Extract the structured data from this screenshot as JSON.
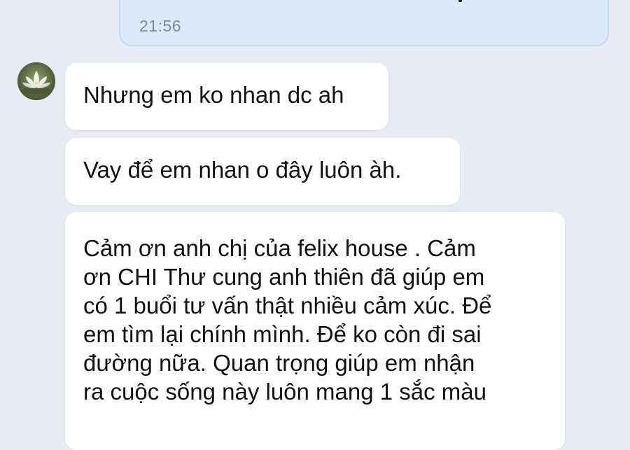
{
  "conversation": {
    "outgoing": {
      "time": "21:56"
    },
    "incoming": [
      {
        "text": "Nhưng em ko nhan dc ah"
      },
      {
        "text": "Vay để em nhan o đây luôn àh."
      },
      {
        "text": "Cảm ơn anh chị của felix house . Cảm\nơn CHI Thư cung anh thiên đã giúp em\ncó 1 buổi tư vấn thật nhiều cảm xúc.  Để\nem tìm lại chính mình. Để ko còn đi sai\nđường nữa.  Quan trọng giúp em nhận\nra cuộc sống này luôn mang 1 sắc màu"
      }
    ],
    "avatar_icon": "lotus-flower-avatar"
  },
  "colors": {
    "background": "#e8ebf3",
    "outgoing_bubble": "#d9ebfa",
    "incoming_bubble": "#ffffff",
    "timestamp": "#7a8a98"
  }
}
